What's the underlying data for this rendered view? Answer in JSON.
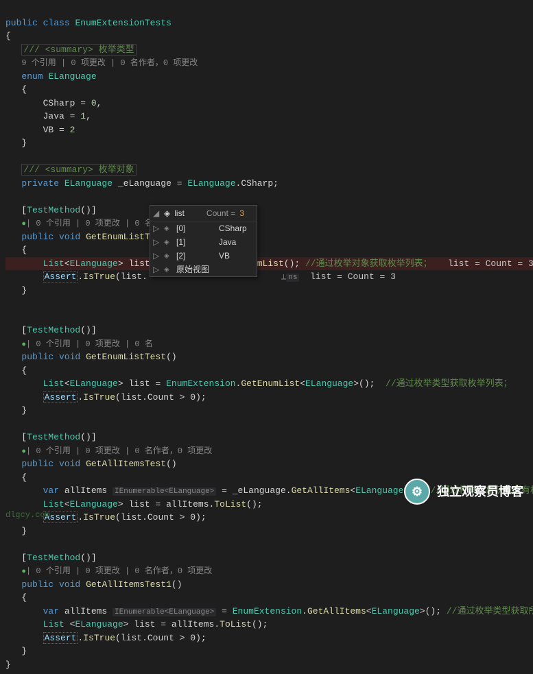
{
  "class_decl": {
    "public": "public",
    "class": "class",
    "name": "EnumExtensionTests"
  },
  "enum_block": {
    "summary": "/// <summary> 枚举类型",
    "codelens": "9 个引用 | 0 项更改 | 0 名作者，0 项更改",
    "decl": {
      "enum": "enum",
      "name": "ELanguage"
    },
    "members": [
      {
        "name": "CSharp",
        "eq": "=",
        "val": "0",
        "comma": ","
      },
      {
        "name": "Java",
        "eq": "=",
        "val": "1",
        "comma": ","
      },
      {
        "name": "VB",
        "eq": "=",
        "val": "2",
        "comma": ""
      }
    ]
  },
  "field": {
    "summary": "/// <summary> 枚举对象",
    "private": "private",
    "type": "ELanguage",
    "name": "_eLanguage",
    "eq": "=",
    "rhs_type": "ELanguage",
    "rhs_member": "CSharp"
  },
  "methods": [
    {
      "attr": "TestMethod",
      "codelens_prefix": "| 0 个引用 | 0 项更改 | 0 名作者，0 项更改",
      "sig": {
        "public": "public",
        "void": "void",
        "name": "GetEnumListTest1"
      },
      "line1": {
        "List": "List",
        "gen": "ELanguage",
        "var": "list",
        "eq": "=",
        "rhs": "_eLanguage",
        "method": "GetEnumList",
        "comment": "//通过枚举对象获取枚举列表；",
        "datatip": "list = Count = 3"
      },
      "line2": {
        "Assert": "Assert",
        "IsTrue": "IsTrue",
        "expr": "list."
      }
    },
    {
      "attr": "TestMethod",
      "codelens_prefix": "| 0 个引用 | 0 项更改 | 0 名",
      "sig": {
        "public": "public",
        "void": "void",
        "name": "GetEnumListTest"
      },
      "line1": {
        "List": "List",
        "gen": "ELanguage",
        "var": "list",
        "eq": "=",
        "rhs_type": "EnumExtension",
        "method": "GetEnumList",
        "gen2": "ELanguage",
        "comment": "//通过枚举类型获取枚举列表；"
      },
      "line2": {
        "Assert": "Assert",
        "IsTrue": "IsTrue",
        "expr": "list.Count > 0"
      }
    },
    {
      "attr": "TestMethod",
      "codelens_prefix": "| 0 个引用 | 0 项更改 | 0 名作者，0 项更改",
      "sig": {
        "public": "public",
        "void": "void",
        "name": "GetAllItemsTest"
      },
      "line1": {
        "var": "var",
        "name": "allItems",
        "hint": "IEnumerable<ELanguage>",
        "eq": "=",
        "rhs": "_eLanguage",
        "method": "GetAllItems",
        "gen": "ELanguage",
        "comment": "//通过枚举对象获取所有枚举；"
      },
      "line2": {
        "List": "List",
        "gen": "ELanguage",
        "var": "list",
        "eq": "=",
        "rhs": "allItems",
        "method": "ToList"
      },
      "line3": {
        "Assert": "Assert",
        "IsTrue": "IsTrue",
        "expr": "list.Count > 0"
      }
    },
    {
      "attr": "TestMethod",
      "codelens_prefix": "| 0 个引用 | 0 项更改 | 0 名作者，0 项更改",
      "sig": {
        "public": "public",
        "void": "void",
        "name": "GetAllItemsTest1"
      },
      "line1": {
        "var": "var",
        "name": "allItems",
        "hint": "IEnumerable<ELanguage>",
        "eq": "=",
        "rhs_type": "EnumExtension",
        "method": "GetAllItems",
        "gen": "ELanguage",
        "comment": "//通过枚举类型获取所有枚举；"
      },
      "line2": {
        "List": "List",
        "gen": "ELanguage",
        "var": "list",
        "eq": "=",
        "rhs": "allItems",
        "method": "ToList"
      },
      "line3": {
        "Assert": "Assert",
        "IsTrue": "IsTrue",
        "expr": "list.Count > 0"
      }
    }
  ],
  "tooltip": {
    "header": {
      "expand": "◢",
      "icon": "◈",
      "var": "list",
      "count_label": "Count =",
      "count_val": "3",
      "pin": "📌",
      "suffix_var": "list",
      "suffix_eq": "=",
      "suffix_count": "Count = 3"
    },
    "rows": [
      {
        "expand": "▷",
        "icon": "◈",
        "key": "[0]",
        "val": "CSharp"
      },
      {
        "expand": "▷",
        "icon": "◈",
        "key": "[1]",
        "val": "Java"
      },
      {
        "expand": "▷",
        "icon": "◈",
        "key": "[2]",
        "val": "VB"
      },
      {
        "expand": "▷",
        "icon": "◈",
        "key": "原始视图",
        "val": ""
      }
    ]
  },
  "watermark": {
    "text": "独立观察员博客",
    "avatar_glyph": "⚙"
  },
  "site": "dlgcy.com",
  "ns_badge": "ns"
}
